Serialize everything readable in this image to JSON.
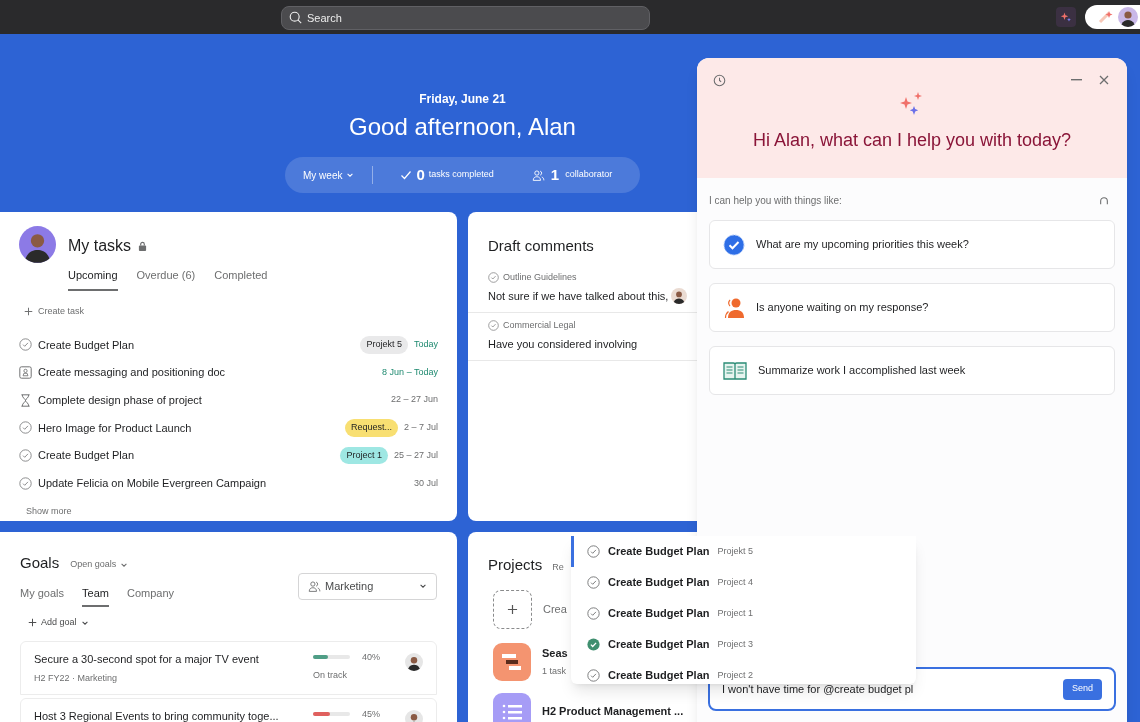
{
  "top_bar": {
    "search": {
      "placeholder": "Search"
    }
  },
  "hero": {
    "date": "Friday, June 21",
    "greeting": "Good afternoon, Alan",
    "period": "My week",
    "tasks_completed": {
      "count": "0",
      "label": "tasks completed"
    },
    "collaborators": {
      "count": "1",
      "label": "collaborator"
    }
  },
  "my_tasks": {
    "title": "My tasks",
    "tabs": [
      {
        "label": "Upcoming",
        "selected": true
      },
      {
        "label": "Overdue (6)",
        "selected": false
      },
      {
        "label": "Completed",
        "selected": false
      }
    ],
    "create_label": "Create task",
    "tasks": [
      {
        "kind": "task",
        "name": "Create Budget Plan",
        "tag": {
          "label": "Projekt 5",
          "color": "#e9e9ea"
        },
        "due": "Today",
        "due_soon": true
      },
      {
        "kind": "approval",
        "name": "Create messaging and positioning doc",
        "due": "8 Jun – Today",
        "due_soon": true
      },
      {
        "kind": "milestone",
        "name": "Complete design phase of project",
        "due": "22 – 27 Jun",
        "due_soon": false
      },
      {
        "kind": "task",
        "name": "Hero Image for Product Launch",
        "tag": {
          "label": "Request...",
          "color": "#f8df72"
        },
        "due": "2 – 7 Jul",
        "due_soon": false
      },
      {
        "kind": "task",
        "name": "Create Budget Plan",
        "tag": {
          "label": "Project 1",
          "color": "#9ee7e3"
        },
        "due": "25 – 27 Jul",
        "due_soon": false
      },
      {
        "kind": "task",
        "name": "Update Felicia on Mobile Evergreen Campaign",
        "due": "30 Jul",
        "due_soon": false
      }
    ],
    "show_more": "Show more"
  },
  "draft_comments": {
    "title": "Draft comments",
    "comments": [
      {
        "task": "Outline Guidelines",
        "text": "Not sure if we have talked about this,",
        "mention": true
      },
      {
        "task": "Commercial Legal",
        "text": "Have you considered involving",
        "mention": false
      }
    ]
  },
  "goals": {
    "title": "Goals",
    "filter": "Open goals",
    "tabs": [
      {
        "label": "My goals",
        "selected": false
      },
      {
        "label": "Team",
        "selected": true
      },
      {
        "label": "Company",
        "selected": false
      }
    ],
    "team_select": "Marketing",
    "add_label": "Add goal",
    "goals": [
      {
        "name": "Secure a 30-second spot for a major TV event",
        "meta": "H2 FY22 · Marketing",
        "level": 0.4,
        "percent": "40%",
        "status": "On track",
        "color": "#4f9e86"
      },
      {
        "name": "Host 3 Regional Events to bring community toge...",
        "level": 0.45,
        "percent": "45%",
        "color": "#e0605e"
      }
    ]
  },
  "projects": {
    "title": "Projects",
    "filter": "Re",
    "create_label": "Crea",
    "projects": [
      {
        "kind": "timeline",
        "name": "Seas",
        "meta": "1 task",
        "color": "#f49470"
      },
      {
        "kind": "list",
        "name": "H2 Product Management ...",
        "color": "#a69cf6"
      }
    ]
  },
  "assistant": {
    "greeting": "Hi Alan, what can I help you with today?",
    "intro": "I can help you with things like:",
    "suggestions": [
      {
        "kind": "priorities",
        "text": "What are my upcoming priorities this week?"
      },
      {
        "kind": "people",
        "text": "Is anyone waiting on my response?"
      },
      {
        "kind": "summary",
        "text": "Summarize work I accomplished last week"
      }
    ],
    "input": {
      "value": "I won't have time for @create budget pl"
    },
    "send_label": "Send",
    "mention_menu": [
      {
        "name": "Create Budget Plan",
        "project": "Projekt 5",
        "completed": false,
        "selected": true
      },
      {
        "name": "Create Budget Plan",
        "project": "Project 4",
        "completed": false,
        "selected": false
      },
      {
        "name": "Create Budget Plan",
        "project": "Project 1",
        "completed": false,
        "selected": false
      },
      {
        "name": "Create Budget Plan",
        "project": "Project 3",
        "completed": true,
        "selected": false
      },
      {
        "name": "Create Budget Plan",
        "project": "Project 2",
        "completed": false,
        "selected": false
      }
    ]
  }
}
